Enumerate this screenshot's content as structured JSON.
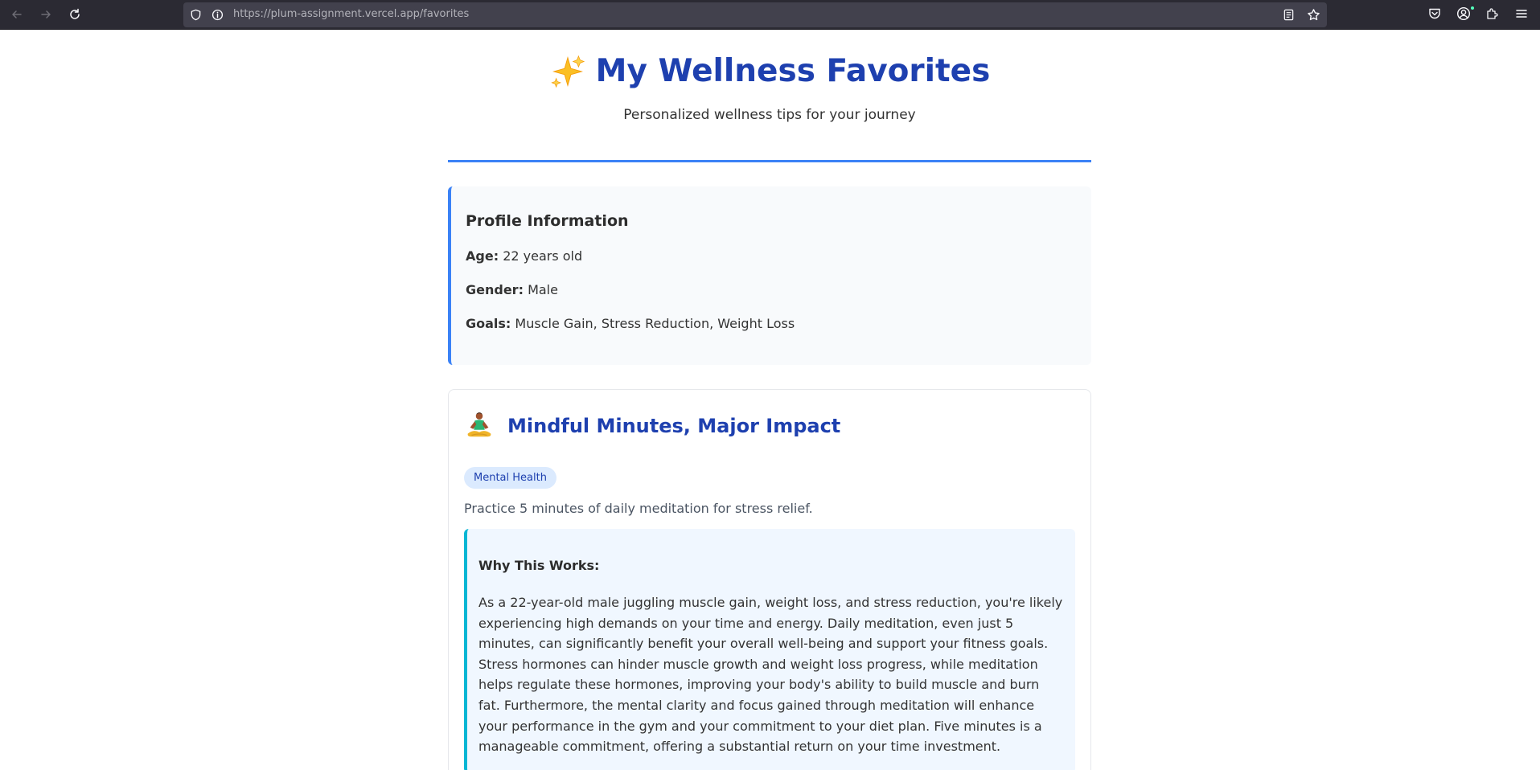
{
  "browser": {
    "url_host": "https://plum-assignment.vercel.app/",
    "url_path": "favorites"
  },
  "hero": {
    "title": "My Wellness Favorites",
    "subtitle": "Personalized wellness tips for your journey",
    "icon": "sparkles-icon"
  },
  "profile": {
    "heading": "Profile Information",
    "age_label": "Age:",
    "age_value": "22 years old",
    "gender_label": "Gender:",
    "gender_value": "Male",
    "goals_label": "Goals:",
    "goals_value": "Muscle Gain, Stress Reduction, Weight Loss"
  },
  "tip": {
    "icon": "meditation-icon",
    "title": "Mindful Minutes, Major Impact",
    "category": "Mental Health",
    "description": "Practice 5 minutes of daily meditation for stress relief.",
    "why_heading": "Why This Works:",
    "why_body": "As a 22-year-old male juggling muscle gain, weight loss, and stress reduction, you're likely experiencing high demands on your time and energy. Daily meditation, even just 5 minutes, can significantly benefit your overall well-being and support your fitness goals. Stress hormones can hinder muscle growth and weight loss progress, while meditation helps regulate these hormones, improving your body's ability to build muscle and burn fat. Furthermore, the mental clarity and focus gained through meditation will enhance your performance in the gym and your commitment to your diet plan. Five minutes is a manageable commitment, offering a substantial return on your time investment."
  },
  "colors": {
    "accent": "#3b82f6",
    "title_blue": "#1e40af",
    "why_border": "#06b6d4",
    "browser_bg": "#2b2a33"
  }
}
